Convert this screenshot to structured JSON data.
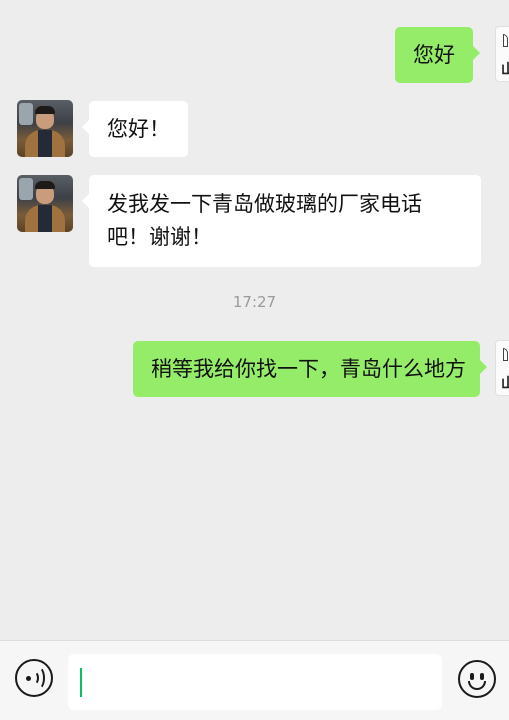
{
  "messages": [
    {
      "sender": "self",
      "text": "您好"
    },
    {
      "sender": "peer",
      "text": "您好！"
    },
    {
      "sender": "peer",
      "line1": "发我发一下青岛做玻璃的厂家电话",
      "line2": "吧！谢谢！"
    },
    {
      "sender": "self",
      "text": "稍等我给你找一下，青岛什么地方"
    }
  ],
  "timestamp": "17:27",
  "self_avatar": {
    "logo": "山"
  },
  "input": {
    "value": ""
  },
  "icons": {
    "voice": "voice-icon",
    "emoji": "emoji-icon"
  },
  "colors": {
    "self_bubble": "#95ec69",
    "peer_bubble": "#ffffff",
    "background": "#ededed",
    "caret": "#07c160"
  }
}
